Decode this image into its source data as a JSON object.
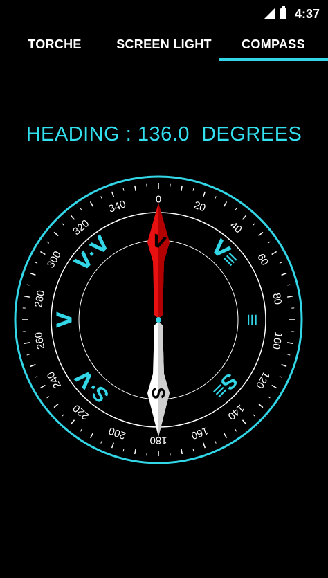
{
  "status_bar": {
    "time": "4:37",
    "icons": [
      "signal-icon",
      "battery-icon"
    ]
  },
  "tabs": [
    {
      "label": "TORCHE",
      "active": false
    },
    {
      "label": "SCREEN LIGHT",
      "active": false
    },
    {
      "label": "COMPASS",
      "active": true
    }
  ],
  "heading": {
    "text": "HEADING : 136.0  DEGREES",
    "value": 136.0
  },
  "compass": {
    "degree_labels": [
      "0",
      "20",
      "40",
      "60",
      "80",
      "100",
      "120",
      "140",
      "160",
      "180",
      "200",
      "220",
      "240",
      "260",
      "280",
      "300",
      "320",
      "340"
    ],
    "direction_glyphs": [
      {
        "label": "ᐯ·ᐯ",
        "angle": 315
      },
      {
        "label": "ᐯ≡",
        "angle": 45
      },
      {
        "label": "ᐯ",
        "angle": 270
      },
      {
        "label": "≡",
        "angle": 90
      },
      {
        "label": "S·ᐯ",
        "angle": 225
      },
      {
        "label": "S≡",
        "angle": 135
      }
    ],
    "needle_north_label": "ᐯ",
    "needle_south_label": "S"
  },
  "colors": {
    "accent": "#33d6e6",
    "needle_north": "#e81010",
    "needle_south": "#ffffff"
  }
}
